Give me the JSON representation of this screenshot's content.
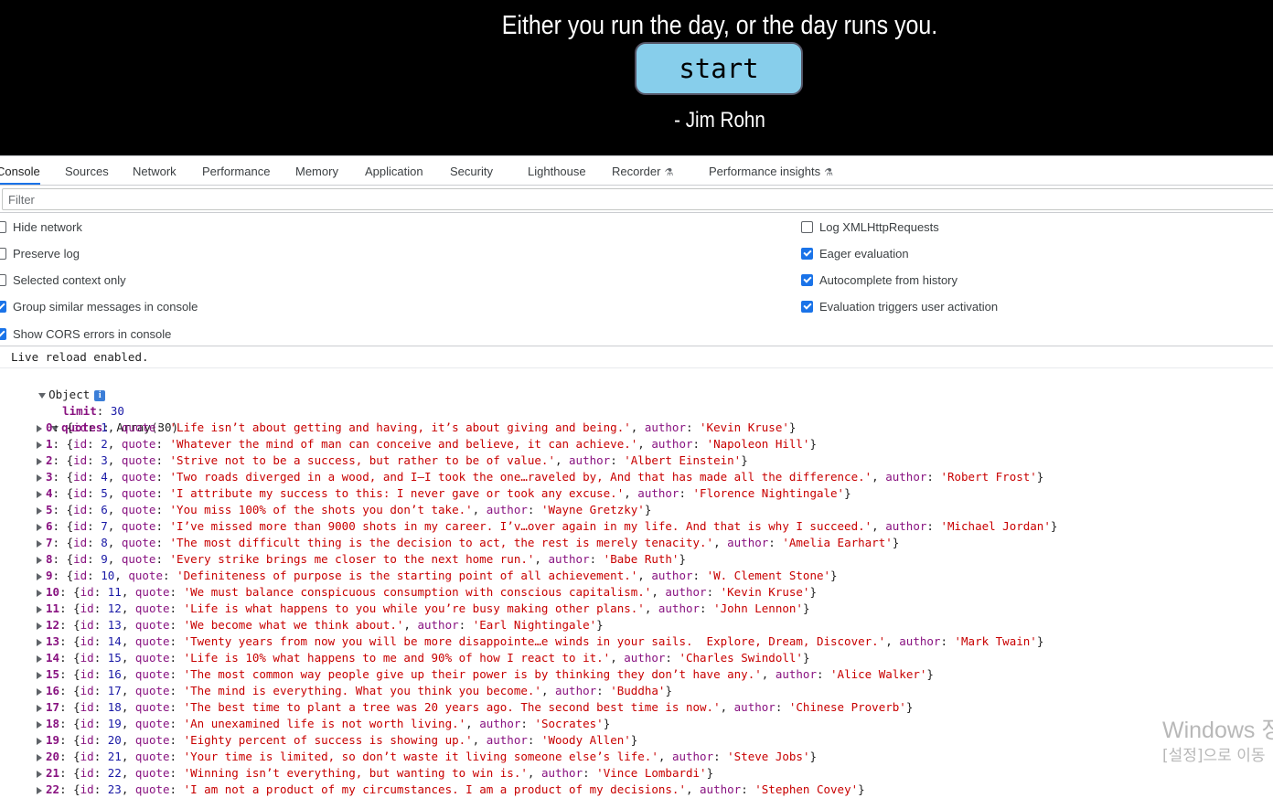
{
  "page": {
    "quote": "Either you run the day, or the day runs you.",
    "start_label": "start",
    "author": "- Jim Rohn"
  },
  "devtools": {
    "tabs": [
      {
        "label": "Console",
        "active": true
      },
      {
        "label": "Sources",
        "active": false
      },
      {
        "label": "Network",
        "active": false
      },
      {
        "label": "Performance",
        "active": false
      },
      {
        "label": "Memory",
        "active": false
      },
      {
        "label": "Application",
        "active": false
      },
      {
        "label": "Security",
        "active": false
      },
      {
        "label": "Lighthouse",
        "active": false
      },
      {
        "label": "Recorder",
        "active": false,
        "icon": "flask-icon"
      },
      {
        "label": "Performance insights",
        "active": false,
        "icon": "flask-icon"
      }
    ],
    "filter_placeholder": "Filter",
    "settings_left": [
      {
        "label": "Hide network",
        "checked": false
      },
      {
        "label": "Preserve log",
        "checked": false
      },
      {
        "label": "Selected context only",
        "checked": false
      },
      {
        "label": "Group similar messages in console",
        "checked": true
      },
      {
        "label": "Show CORS errors in console",
        "checked": true
      }
    ],
    "settings_right": [
      {
        "label": "Log XMLHttpRequests",
        "checked": false
      },
      {
        "label": "Eager evaluation",
        "checked": true
      },
      {
        "label": "Autocomplete from history",
        "checked": true
      },
      {
        "label": "Evaluation triggers user activation",
        "checked": true
      }
    ]
  },
  "console": {
    "live_reload": "Live reload enabled.",
    "object_label": "Object",
    "info_badge": "i",
    "limit_key": "limit",
    "limit_value": "30",
    "quotes_key": "quotes",
    "quotes_type": "Array(30)",
    "quotes": [
      {
        "index": "0",
        "id": "1",
        "quote": "'Life isn’t about getting and having, it’s about giving and being.'",
        "author": "'Kevin Kruse'"
      },
      {
        "index": "1",
        "id": "2",
        "quote": "'Whatever the mind of man can conceive and believe, it can achieve.'",
        "author": "'Napoleon Hill'"
      },
      {
        "index": "2",
        "id": "3",
        "quote": "'Strive not to be a success, but rather to be of value.'",
        "author": "'Albert Einstein'"
      },
      {
        "index": "3",
        "id": "4",
        "quote": "'Two roads diverged in a wood, and I—I took the one…raveled by, And that has made all the difference.'",
        "author": "'Robert Frost'"
      },
      {
        "index": "4",
        "id": "5",
        "quote": "'I attribute my success to this: I never gave or took any excuse.'",
        "author": "'Florence Nightingale'"
      },
      {
        "index": "5",
        "id": "6",
        "quote": "'You miss 100% of the shots you don’t take.'",
        "author": "'Wayne Gretzky'"
      },
      {
        "index": "6",
        "id": "7",
        "quote": "'I’ve missed more than 9000 shots in my career. I’v…over again in my life. And that is why I succeed.'",
        "author": "'Michael Jordan'"
      },
      {
        "index": "7",
        "id": "8",
        "quote": "'The most difficult thing is the decision to act, the rest is merely tenacity.'",
        "author": "'Amelia Earhart'"
      },
      {
        "index": "8",
        "id": "9",
        "quote": "'Every strike brings me closer to the next home run.'",
        "author": "'Babe Ruth'"
      },
      {
        "index": "9",
        "id": "10",
        "quote": "'Definiteness of purpose is the starting point of all achievement.'",
        "author": "'W. Clement Stone'"
      },
      {
        "index": "10",
        "id": "11",
        "quote": "'We must balance conspicuous consumption with conscious capitalism.'",
        "author": "'Kevin Kruse'"
      },
      {
        "index": "11",
        "id": "12",
        "quote": "'Life is what happens to you while you’re busy making other plans.'",
        "author": "'John Lennon'"
      },
      {
        "index": "12",
        "id": "13",
        "quote": "'We become what we think about.'",
        "author": "'Earl Nightingale'"
      },
      {
        "index": "13",
        "id": "14",
        "quote": "'Twenty years from now you will be more disappointe…e winds in your sails.  Explore, Dream, Discover.'",
        "author": "'Mark Twain'"
      },
      {
        "index": "14",
        "id": "15",
        "quote": "'Life is 10% what happens to me and 90% of how I react to it.'",
        "author": "'Charles Swindoll'"
      },
      {
        "index": "15",
        "id": "16",
        "quote": "'The most common way people give up their power is by thinking they don’t have any.'",
        "author": "'Alice Walker'"
      },
      {
        "index": "16",
        "id": "17",
        "quote": "'The mind is everything. What you think you become.'",
        "author": "'Buddha'"
      },
      {
        "index": "17",
        "id": "18",
        "quote": "'The best time to plant a tree was 20 years ago. The second best time is now.'",
        "author": "'Chinese Proverb'"
      },
      {
        "index": "18",
        "id": "19",
        "quote": "'An unexamined life is not worth living.'",
        "author": "'Socrates'"
      },
      {
        "index": "19",
        "id": "20",
        "quote": "'Eighty percent of success is showing up.'",
        "author": "'Woody Allen'"
      },
      {
        "index": "20",
        "id": "21",
        "quote": "'Your time is limited, so don’t waste it living someone else’s life.'",
        "author": "'Steve Jobs'"
      },
      {
        "index": "21",
        "id": "22",
        "quote": "'Winning isn’t everything, but wanting to win is.'",
        "author": "'Vince Lombardi'"
      },
      {
        "index": "22",
        "id": "23",
        "quote": "'I am not a product of my circumstances. I am a product of my decisions.'",
        "author": "'Stephen Covey'"
      }
    ]
  },
  "watermark": {
    "line1": "Windows 정",
    "line2": "[설정]으로 이동"
  },
  "colors": {
    "start_button": "#87ceeb",
    "active_tab": "#1a73e8",
    "string": "#c80000",
    "number": "#1a1aa6",
    "key": "#881280"
  }
}
